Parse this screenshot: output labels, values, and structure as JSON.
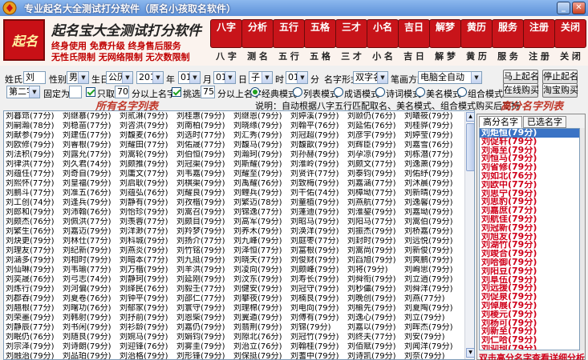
{
  "window": {
    "title": "专业起名大全测试打分软件（原名小孩取名软件）",
    "minimize": "_",
    "close": "✕"
  },
  "banner": {
    "logo_text": "起名",
    "brand": "起名宝大全测试打分软件",
    "slogan1": "终身使用  免费升级  终身售后服务",
    "slogan2": "无性氏限制  无网络限制  无次数限制",
    "nav": [
      {
        "icon": "八字",
        "label": "八 字"
      },
      {
        "icon": "分析",
        "label": "测 名"
      },
      {
        "icon": "五行",
        "label": "五 行"
      },
      {
        "icon": "五格",
        "label": "五 格"
      },
      {
        "icon": "三才",
        "label": "三 才"
      },
      {
        "icon": "小名",
        "label": "小 名"
      },
      {
        "icon": "吉日",
        "label": "吉 日"
      },
      {
        "icon": "解梦",
        "label": "解 梦"
      },
      {
        "icon": "黄历",
        "label": "黄 历"
      },
      {
        "icon": "服务",
        "label": "服 务"
      },
      {
        "icon": "注册",
        "label": "注 册"
      },
      {
        "icon": "关闭",
        "label": "关 闭"
      }
    ]
  },
  "form": {
    "surname_label": "姓氏",
    "surname": "刘",
    "gender_label": "性别",
    "gender": "男",
    "birthday_label": "生日",
    "calendar": "公历",
    "year": "2010",
    "year_unit": "年",
    "month": "01",
    "month_unit": "月",
    "day": "01",
    "day_unit": "日",
    "hour": "子 0",
    "hour_unit": "时",
    "minute": "01",
    "minute_unit": "分",
    "name_form_label": "名字形式",
    "name_form": "双字名",
    "strokes_label": "笔画方案",
    "strokes": "电脑全自动",
    "start_button": "马上起名",
    "stop_button": "停止起名",
    "position": "第二字",
    "fixed_label": "固定为",
    "fixed_value": "",
    "only_label": "只取",
    "only_value": "70",
    "above_label": "分以上名字",
    "pick_label": "挑选",
    "pick_value": "75",
    "pick_above_label": "分以上名字",
    "modes": [
      "经典模式",
      "列表模式",
      "成语模式",
      "诗词模式",
      "美名模式",
      "组合模式"
    ],
    "buy_online": "在线购买",
    "taobao_buy": "淘宝购买"
  },
  "section": {
    "left_title": "所有名字列表",
    "note": "说明：自动根据八字五行匹配取名、美名模式、组合模式购买后支持",
    "right_title": "高分名字列表"
  },
  "names": [
    [
      "刘暮筇(77分)",
      "刘继慕(79分)",
      "刘贰淋(79分)",
      "刘桂惠(79分)",
      "刘继恩(79分)",
      "刘婷溪(79分)",
      "刘颐仍(76分)",
      "刘曦筱(79分)"
    ],
    [
      "刘嗣瀚(78分)",
      "刘稳苗(77分)",
      "刘咨洪(79分)",
      "刘南柏(79分)",
      "刘晓缘(79分)",
      "刘翰平(76分)",
      "刘延佑(76分)",
      "刘桂骅(79分)"
    ],
    [
      "刘献参(79分)",
      "刘建伍(77分)",
      "刘馥麦(76分)",
      "刘选时(77分)",
      "刘汇秀(79分)",
      "刘冠超(79分)",
      "刘彦宇(79分)",
      "刘婷莹(79分)"
    ],
    [
      "刘欧修(79分)",
      "刘睿根(79分)",
      "刘耀田(77分)",
      "刘佑晟(77分)",
      "刘馥马(79分)",
      "刘馥歆(79分)",
      "刘辉臣(79分)",
      "刘嘉雪(76分)"
    ],
    [
      "刘法积(79分)",
      "刘露允(77分)",
      "刘嵩轮(79分)",
      "刘伯恒(79分)",
      "刘瀚珂(79分)",
      "刘孙赫(79分)",
      "刘孕凉(79分)",
      "刘栋潜(77分)"
    ],
    [
      "刘律洪(77分)",
      "刘久君(74分)",
      "刘颇推(79分)",
      "刘冠渠(79分)",
      "刘斯耀(79分)",
      "刘淮岭(79分)",
      "刘颇文(77分)",
      "刘逸萧(79分)"
    ],
    [
      "刘蕴任(77分)",
      "刘奇自(79分)",
      "刘庸文(77分)",
      "刘韦嘉(79分)",
      "刘耀至(79分)",
      "刘贤许(77分)",
      "刘泰钧(79分)",
      "刘佑纾(79分)"
    ],
    [
      "刘熙怀(77分)",
      "刘皇福(79分)",
      "刘启耿(79分)",
      "刘棋渠(79分)",
      "刘禹耀(76分)",
      "刘致梅(79分)",
      "刘嘉涵(77分)",
      "刘沐晨(79分)"
    ],
    [
      "刘鹏斗(77分)",
      "刘准五(76分)",
      "刘蕴弘(76分)",
      "刘耀良(79分)",
      "刘鲤兵(79分)",
      "刘干佑(74分)",
      "刘樟坳(77分)",
      "刘新晴(79分)"
    ],
    [
      "刘工创(74分)",
      "刘逢兵(79分)",
      "刘静有(79分)",
      "刘孜楷(79分)",
      "刘繁迈(78分)",
      "刘童植(79分)",
      "刘燕航(77分)",
      "刘逸馨(79分)"
    ],
    [
      "刘郎和(79分)",
      "刘沛翰(76分)",
      "刘怡珍(79分)",
      "刘嵩召(79分)",
      "刘锦逸(77分)",
      "刘蓬迪(79分)",
      "刘淮鋆(79分)",
      "刘嘉坳(79分)"
    ],
    [
      "刘颇杰(76分)",
      "刘佩洪(77分)",
      "刘羡蓉(77分)",
      "刘颇目(79分)",
      "刘高军(79分)",
      "刘昭马(79分)",
      "刘阳马(77分)",
      "刘嵩伯(79分)"
    ],
    [
      "刘繁生(76分)",
      "刘嘉迈(79分)",
      "刘洋渺(77分)",
      "刘羚梦(79分)",
      "刘养木(79分)",
      "刘涣洋(79分)",
      "刘振杰(79分)",
      "刘桥嘉(79分)"
    ],
    [
      "刘炔更(79分)",
      "刘林仕(77分)",
      "刘科城(79分)",
      "刘扬介(77分)",
      "刘九峰(79分)",
      "刘庭枣(77分)",
      "刘封时(79分)",
      "刘远悦(79分)"
    ],
    [
      "刘理友(77分)",
      "刘纪新(79分)",
      "刘燕炎(79分)",
      "刘竹铭(79分)",
      "刘泽恒(77分)",
      "刘富根(79分)",
      "刘嵩尚(79分)",
      "刘新俊(79分)"
    ],
    [
      "刘涵多(79分)",
      "刘相时(79分)",
      "刘暗本(77分)",
      "刘九挺(79分)",
      "刘晓天(77分)",
      "刘俊财(79分)",
      "刘舀旭(79分)",
      "刘爽鹏(79分)"
    ],
    [
      "刘仙琳(79分)",
      "刘韦瑜(77分)",
      "刘万楷(79分)",
      "刘羊洪(79分)",
      "刘凌向(79分)",
      "刘颇峰(79分)",
      "刘将(79分)",
      "刘峋思(79分)"
    ],
    [
      "刘奕晟(76分)",
      "刘弓志(74分)",
      "刘静珂(79分)",
      "刘延刚(79分)",
      "刘汶东(79分)",
      "刘寿长(79分)",
      "刘舜衔(79分)",
      "刘立逍(79分)"
    ],
    [
      "刘炼行(79分)",
      "刘河偏(79分)",
      "刘绎民(76分)",
      "刘毅壬(77分)",
      "刘健安(79分)",
      "刘冠守(79分)",
      "刘秒儡(79分)",
      "刘舜洋(79分)"
    ],
    [
      "刘郡吞(79分)",
      "刘夏卷(76分)",
      "刘钟平(79分)",
      "刘邵仁(77分)",
      "刘攀夜(79分)",
      "刘楠艮(79分)",
      "刘晚创(79分)",
      "刘燕(77分)"
    ],
    [
      "刘翘根(77分)",
      "刘曙功(76分)",
      "刘郁家(79分)",
      "刘寰守(79分)",
      "刘理棉(79分)",
      "刘电向(79分)",
      "刘榆先(79分)",
      "刘夏陶(79分)"
    ],
    [
      "刘荣墨(79分)",
      "刘韩射(79分)",
      "刘抒前(79分)",
      "刘恩柴(79分)",
      "刘翼遁(79分)",
      "刘傅有(79分)",
      "刘逸心(79分)",
      "刘立(79分)"
    ],
    [
      "刘静辰(77分)",
      "刘书闲(79分)",
      "刘衫龄(79分)",
      "刘嘉仍(79分)",
      "刘翡荆(79分)",
      "刘锦(79分)",
      "刘嘉以(79分)",
      "刘晖杰(79分)"
    ],
    [
      "刘眠仍(76分)",
      "刘随艮(79分)",
      "刘婉马(79分)",
      "刘娟钧(79分)",
      "刘隙北(76分)",
      "刘冠竹(79分)",
      "刘终夫(77分)",
      "刘安(79分)"
    ],
    [
      "刘宗泽(79分)",
      "刘诗朗(79分)",
      "刘迎锋(76分)",
      "刘雾圭(79分)",
      "刘治立(76分)",
      "刘翰桂(79分)",
      "刘佰赋(79分)",
      "刘闻洋(79分)"
    ],
    [
      "刘融治(79分)",
      "刘品珀(79分)",
      "刘治格(79分)",
      "刘形锋(79分)",
      "刘保挺(79分)",
      "刘蓍中(79分)",
      "刘诗凯(79分)",
      "刘奈(79分)"
    ]
  ],
  "right": {
    "tab1": "高分名字",
    "tab2": "已选名字",
    "items": [
      "刘炬恒(79分)",
      "刘促轩(79分)",
      "刘海至(79分)",
      "刘恒马(79分)",
      "刘省修(79分)",
      "刘如北(76分)",
      "刘欧中(77分)",
      "刘思宁(79分)",
      "刘思豹(79分)",
      "刘嘉庶(77分)",
      "刘航佳(79分)",
      "刘冠新(79分)",
      "刘旭友(79分)",
      "刘湖竹(79分)",
      "刘竣合(79分)",
      "刘哈御(79分)",
      "刘阳豆(79分)",
      "刘阜伍(79分)",
      "刘远援(79分)",
      "刘促泉(79分)",
      "刘倬展(79分)",
      "刘棱元(79分)",
      "刘杨可(79分)",
      "刘新至(79分)",
      "刘仁哈(79分)",
      "刘迎珂(79分)",
      "刘爱宾(79分)",
      "刘进行(79分)"
    ],
    "footer": "双击高分名字查看详细分析"
  }
}
